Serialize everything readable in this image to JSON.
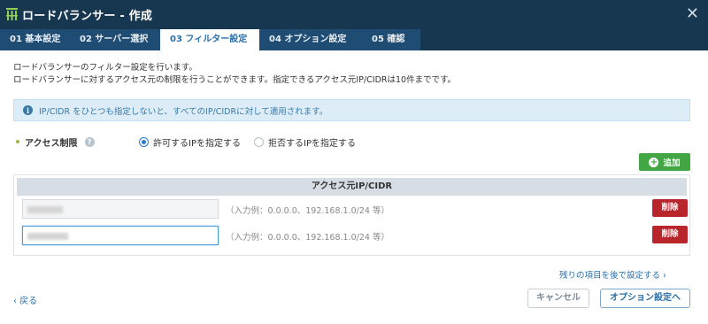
{
  "window": {
    "title": "ロードバランサー - 作成",
    "close_glyph": "✕",
    "logo_icon": "load-balancer-icon"
  },
  "tabs": [
    {
      "label": "01 基本設定",
      "active": false
    },
    {
      "label": "02 サーバー選択",
      "active": false
    },
    {
      "label": "03 フィルター設定",
      "active": true
    },
    {
      "label": "04 オプション設定",
      "active": false
    },
    {
      "label": "05 確認",
      "active": false
    }
  ],
  "description": {
    "line1": "ロードバランサーのフィルター設定を行います。",
    "line2": "ロードバランサーに対するアクセス元の制限を行うことができます。指定できるアクセス元IP/CIDRは10件までです。"
  },
  "info": {
    "text": "IP/CIDR をひとつも指定しないと、すべてのIP/CIDRに対して適用されます。",
    "icon": "info-icon"
  },
  "access": {
    "label": "アクセス制限",
    "help_glyph": "?",
    "options": [
      {
        "label": "許可するIPを指定する",
        "checked": true
      },
      {
        "label": "拒否するIPを指定する",
        "checked": false
      }
    ]
  },
  "add_button": {
    "label": "追加",
    "icon_glyph": "+"
  },
  "table": {
    "header": "アクセス元IP/CIDR",
    "rows": [
      {
        "value": "",
        "example": "（入力例：0.0.0.0、192.168.1.0/24 等）",
        "delete_label": "削除",
        "focused": false
      },
      {
        "value": "",
        "example": "（入力例：0.0.0.0、192.168.1.0/24 等）",
        "delete_label": "削除",
        "focused": true
      }
    ]
  },
  "footer": {
    "later_link": "残りの項目を後で設定する ›",
    "back_link": "‹ 戻る",
    "cancel": "キャンセル",
    "next": "オプション設定へ"
  },
  "colors": {
    "titlebar": "#17364f",
    "tabbar": "#1f4c72",
    "accent": "#2a6fa8",
    "add_green": "#41a643",
    "delete_red": "#b8262c",
    "info_bg": "#dcedf8"
  }
}
